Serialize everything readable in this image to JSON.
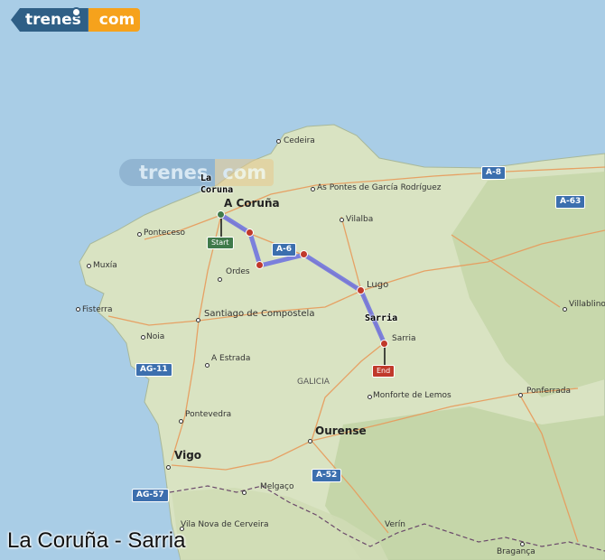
{
  "brand": {
    "left": "trenes",
    "right": "com",
    "watermark_left": "trenes",
    "watermark_right": "com"
  },
  "title": "La Coruña - Sarria",
  "route": {
    "origin_label_line1": "La",
    "origin_label_line2": "Coruna",
    "destination_label": "Sarria",
    "start_tag": "Start",
    "end_tag": "End",
    "line_color": "#6a6fe0",
    "start_color": "#3f7a4a",
    "stop_color": "#c0392b"
  },
  "places": {
    "cedeira": "Cedeira",
    "pontes": "As Pontes de García Rodríguez",
    "acoruna": "A Coruña",
    "vilalba": "Vilalba",
    "ponteceso": "Ponteceso",
    "muxia": "Muxía",
    "ordes": "Ordes",
    "fisterra": "Fisterra",
    "lugo": "Lugo",
    "santiago": "Santiago de Compostela",
    "noia": "Noia",
    "sarria": "Sarria",
    "aestrada": "A Estrada",
    "galicia": "GALICIA",
    "monforte": "Monforte de Lemos",
    "ponferrada": "Ponferrada",
    "pontevedra": "Pontevedra",
    "ourense": "Ourense",
    "vigo": "Vigo",
    "melgaco": "Melgaço",
    "vilanova": "Vila Nova de Cerveira",
    "verin": "Verín",
    "braganca": "Bragança",
    "villablino": "Villablino"
  },
  "highways": {
    "a8": "A-8",
    "a6": "A-6",
    "a63": "A-63",
    "ag11": "AG-11",
    "a52": "A-52",
    "ag57": "AG-57"
  },
  "colors": {
    "sea": "#a9cde6",
    "land": "#d9e3c2",
    "highway": "#3c6fae"
  }
}
